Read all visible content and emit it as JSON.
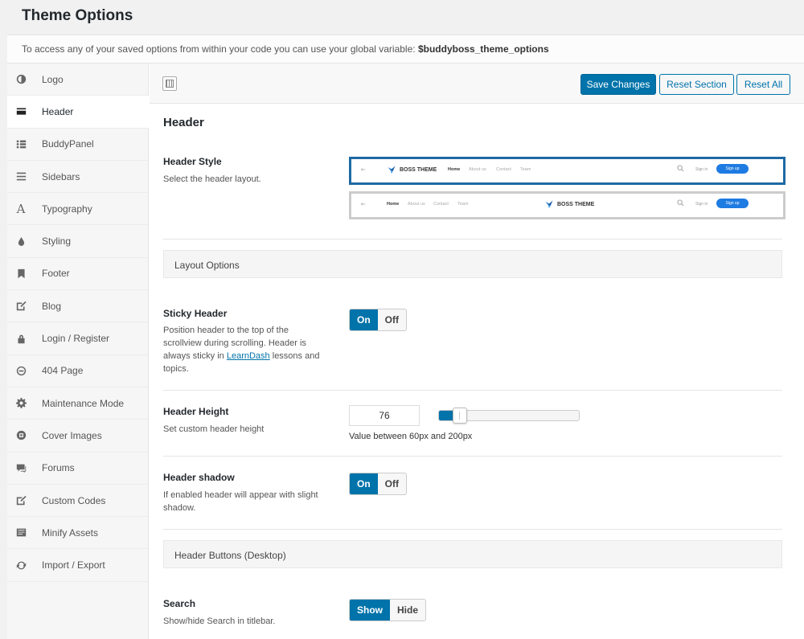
{
  "page": {
    "title": "Theme Options",
    "notice_text": "To access any of your saved options from within your code you can use your global variable:",
    "notice_var": "$buddyboss_theme_options"
  },
  "sidebar": {
    "items": [
      {
        "label": "Logo",
        "icon": "contrast-icon"
      },
      {
        "label": "Header",
        "icon": "card-icon",
        "active": true
      },
      {
        "label": "BuddyPanel",
        "icon": "list-icon"
      },
      {
        "label": "Sidebars",
        "icon": "menu-icon"
      },
      {
        "label": "Typography",
        "icon": "font-icon"
      },
      {
        "label": "Styling",
        "icon": "drop-icon"
      },
      {
        "label": "Footer",
        "icon": "bookmark-icon"
      },
      {
        "label": "Blog",
        "icon": "edit-icon"
      },
      {
        "label": "Login / Register",
        "icon": "lock-icon"
      },
      {
        "label": "404 Page",
        "icon": "minus-circle-icon"
      },
      {
        "label": "Maintenance Mode",
        "icon": "gear-icon"
      },
      {
        "label": "Cover Images",
        "icon": "camera-icon"
      },
      {
        "label": "Forums",
        "icon": "chat-icon"
      },
      {
        "label": "Custom Codes",
        "icon": "edit-icon"
      },
      {
        "label": "Minify Assets",
        "icon": "document-icon"
      },
      {
        "label": "Import / Export",
        "icon": "refresh-icon"
      }
    ]
  },
  "toolbar": {
    "save_label": "Save Changes",
    "reset_section_label": "Reset Section",
    "reset_all_label": "Reset All"
  },
  "section": {
    "title": "Header",
    "header_style": {
      "title": "Header Style",
      "desc": "Select the header layout.",
      "preview": {
        "logo": "BOSS THEME",
        "nav": [
          "Home",
          "About us",
          "Contact",
          "Team"
        ],
        "signin": "Sign in",
        "signup": "Sign up"
      }
    },
    "layout_options": "Layout Options",
    "sticky": {
      "title": "Sticky Header",
      "desc_pre": "Position header to the top of the scrollview during scrolling. Header is always sticky in",
      "link": "LearnDash",
      "desc_post": "lessons and topics.",
      "on": "On",
      "off": "Off",
      "value": "On"
    },
    "height": {
      "title": "Header Height",
      "desc": "Set custom header height",
      "value": "76",
      "min": 60,
      "max": 200,
      "hint": "Value between 60px and 200px"
    },
    "shadow": {
      "title": "Header shadow",
      "desc": "If enabled header will appear with slight shadow.",
      "on": "On",
      "off": "Off",
      "value": "On"
    },
    "buttons_group": "Header Buttons (Desktop)",
    "search": {
      "title": "Search",
      "desc": "Show/hide Search in titlebar.",
      "show": "Show",
      "hide": "Hide",
      "value": "Show"
    }
  },
  "colors": {
    "accent": "#0073aa",
    "selected_border": "#1e6aa3"
  }
}
